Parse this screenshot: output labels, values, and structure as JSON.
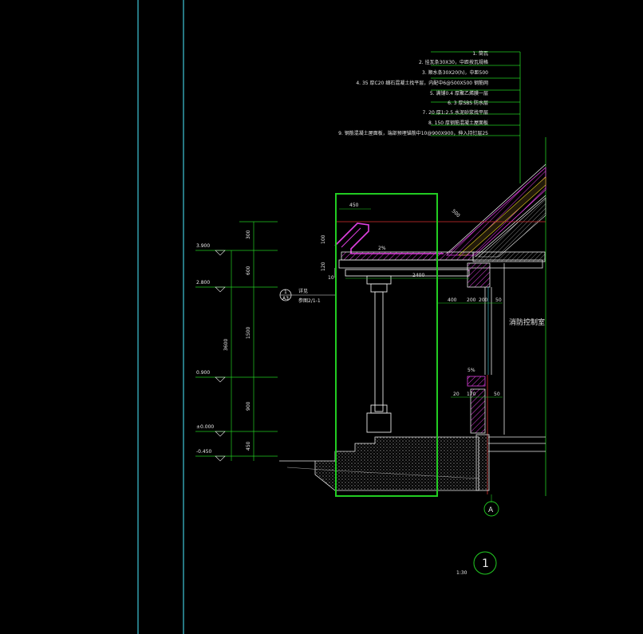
{
  "notes": [
    "1. 筒瓦",
    "2. 挂瓦条30X30，中距按瓦规格",
    "3. 顺水条30X20(h)，中距500",
    "4. 35 厚C20 细石混凝土找平层，内配中6@500X500 钢筋网",
    "5. 满铺0.4 厚聚乙烯膜一层",
    "6. 3 厚SBS 防水层",
    "7. 20 厚1:2.5 水泥砂浆找平层",
    "8. 150 厚钢筋混凝土屋面板",
    "9. 钢筋混凝土屋面板，端部预埋锚筋中10@900X900，伸入持钉层25"
  ],
  "levels": [
    "3.900",
    "2.800",
    "0.900",
    "±0.000",
    "-0.450"
  ],
  "left_dims": [
    "300",
    "600",
    "1500",
    "900",
    "450"
  ],
  "total_dim": "3600",
  "eave_dims": [
    "450",
    "100",
    "120",
    "10"
  ],
  "slope_dim": "500",
  "beam_dim": "2400",
  "beam_dim_small": "2%",
  "wall_dims": [
    "400",
    "200",
    "200",
    "50"
  ],
  "window_dims": [
    "20",
    "170",
    "50"
  ],
  "window_top": "5%",
  "room_label": "消防控制室",
  "callout": {
    "num": "1",
    "sub": "A3",
    "title": "详见",
    "ref": "参图2/1-1"
  },
  "axis_label": "A",
  "detail_number": "1",
  "scale": "1:30",
  "colors": {
    "cyan": "#3fc6d8",
    "green": "#22cc22",
    "magenta": "#e040e0",
    "red": "#d83030",
    "white": "#e8e8e8",
    "yellow": "#e8d020"
  }
}
